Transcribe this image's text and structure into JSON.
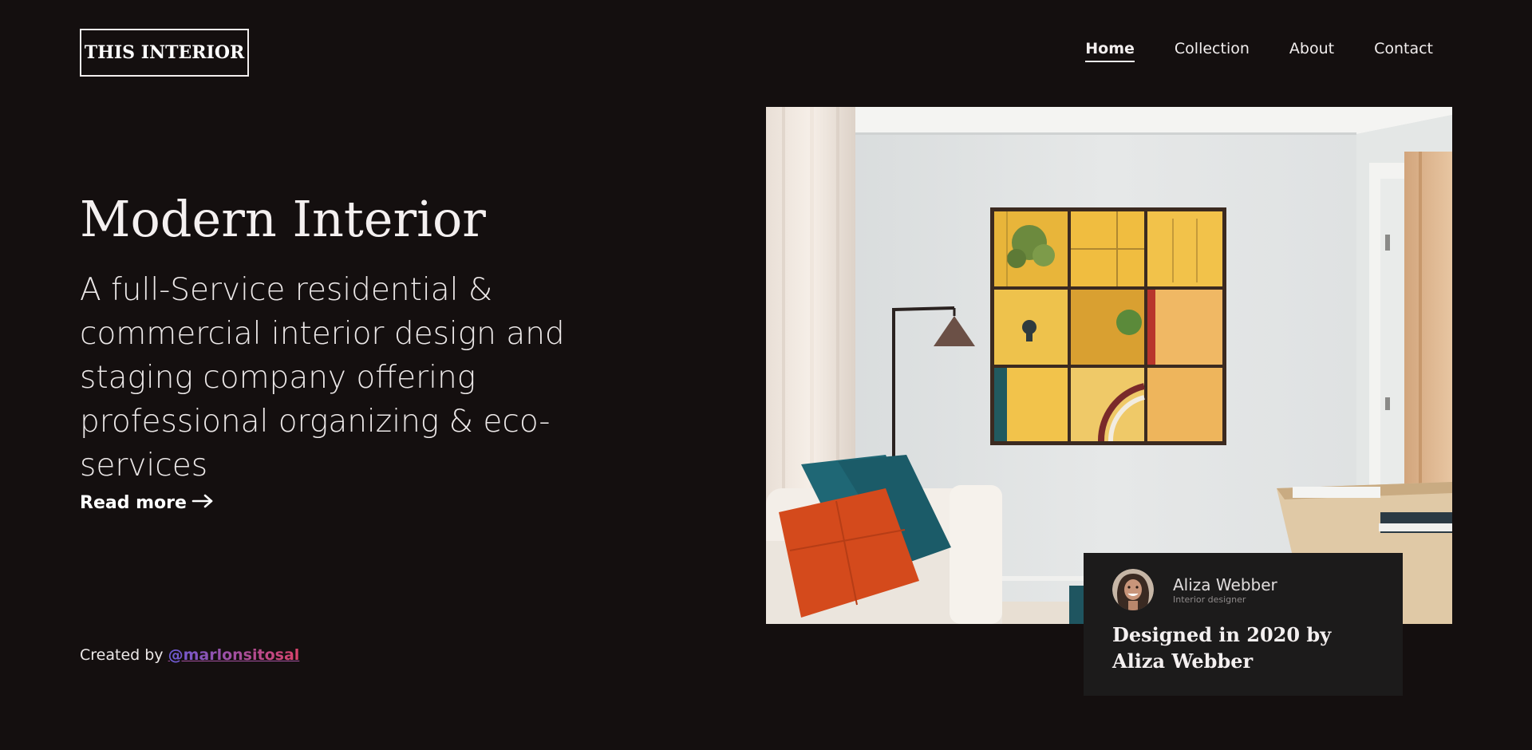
{
  "brand": {
    "logo_text": "THIS INTERIOR"
  },
  "nav": {
    "items": [
      {
        "label": "Home",
        "active": true
      },
      {
        "label": "Collection",
        "active": false
      },
      {
        "label": "About",
        "active": false
      },
      {
        "label": "Contact",
        "active": false
      }
    ]
  },
  "hero": {
    "title": "Modern Interior",
    "description": "A full-Service residential & commercial interior design and staging company offering professional organizing & eco-services",
    "read_more_label": "Read more",
    "read_more_arrow": "→"
  },
  "footer": {
    "credit_prefix": "Created by",
    "credit_handle": "@marlonsitosal"
  },
  "card": {
    "author_name": "Aliza Webber",
    "author_role": "Interior designer",
    "title": "Designed in 2020 by Aliza Webber"
  },
  "icons": {
    "arrow": "arrow-right-icon"
  },
  "colors": {
    "background": "#140f0f",
    "card_background": "#1c1b1b",
    "text": "#f2eeee",
    "handle_gradient_start": "#6a5bd6",
    "handle_gradient_end": "#d9436b"
  }
}
